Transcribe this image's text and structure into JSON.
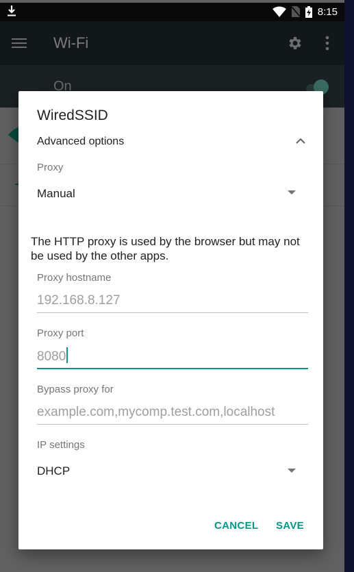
{
  "status_bar": {
    "time": "8:15",
    "icons": [
      "download-icon",
      "wifi-icon",
      "no-sim-icon",
      "battery-charging-icon"
    ]
  },
  "app_bar": {
    "title": "Wi-Fi",
    "icons": [
      "menu-icon",
      "gear-icon",
      "more-vert-icon"
    ]
  },
  "wifi_toggle": {
    "label": "On",
    "enabled": true
  },
  "dialog": {
    "title": "WiredSSID",
    "advanced_options_label": "Advanced options",
    "proxy": {
      "label": "Proxy",
      "selected": "Manual"
    },
    "proxy_note": "The HTTP proxy is used by the browser but may not be used by the other apps.",
    "proxy_hostname": {
      "label": "Proxy hostname",
      "placeholder": "192.168.8.127",
      "value": ""
    },
    "proxy_port": {
      "label": "Proxy port",
      "placeholder": "8080",
      "value": ""
    },
    "bypass_proxy": {
      "label": "Bypass proxy for",
      "placeholder": "example.com,mycomp.test.com,localhost",
      "value": ""
    },
    "ip_settings": {
      "label": "IP settings",
      "selected": "DHCP"
    },
    "buttons": {
      "cancel": "CANCEL",
      "save": "SAVE"
    }
  },
  "colors": {
    "accent": "#009688",
    "scrim": "#616161",
    "status_bar": "#0a0a0b",
    "app_bar": "#121719"
  }
}
